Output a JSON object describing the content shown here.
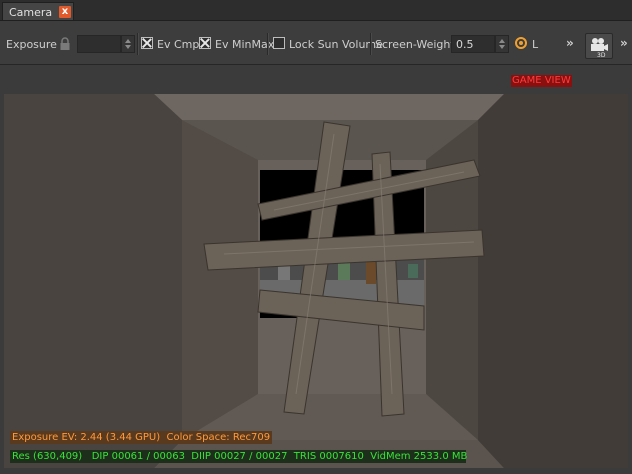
{
  "tab": {
    "label": "Camera",
    "close": "x"
  },
  "toolbar": {
    "exposure_label": "Exposure",
    "exposure_value": "",
    "ev_cmp_label": "Ev Cmp",
    "ev_cmp_checked": true,
    "ev_minmax_label": "Ev MinMax",
    "ev_minmax_checked": true,
    "lock_sun_label": "Lock Sun Volume",
    "lock_sun_checked": false,
    "screen_weight_label": "Screen-Weight",
    "screen_weight_value": "0.5",
    "radio_label": "L",
    "overflow1": "»",
    "overflow2": "»",
    "camera_mode_badge": "3D"
  },
  "viewport": {
    "game_view_label": "GAME VIEW",
    "exposure_info": "Exposure EV: 2.44 (3.44 GPU)  Color Space: Rec709",
    "stats_info": "Res (630,409)   DIP 00061 / 00063  DIIP 00027 / 00027  TRIS 0007610  VidMem 2533.0 MB"
  },
  "colors": {
    "accent": "#f0a030",
    "close": "#e05a2b",
    "hud_orange": "#ff9a3c",
    "hud_green": "#39e23a",
    "game_view": "#ff3b3b"
  }
}
